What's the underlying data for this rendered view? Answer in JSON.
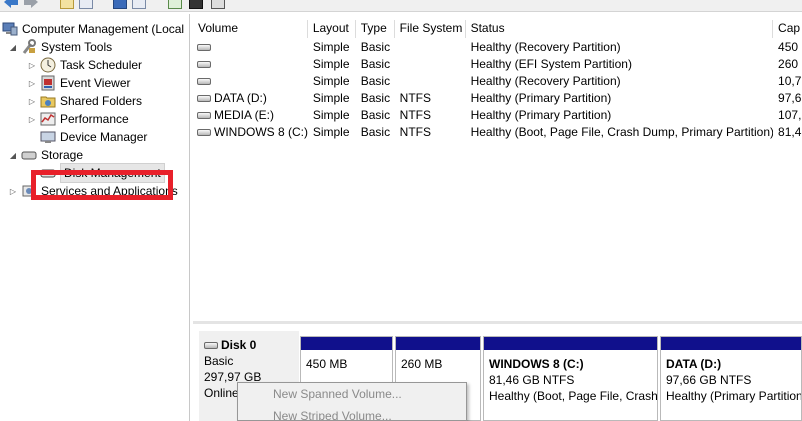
{
  "toolbar": {
    "buttons": [
      "back-arrow-icon",
      "forward-arrow-icon",
      "folder-up-icon",
      "show-hide-tree-icon",
      "help-icon",
      "show-hide-action-pane-icon",
      "export-icon",
      "properties-icon",
      "settings-icon"
    ]
  },
  "tree": {
    "root": "Computer Management (Local",
    "system_tools": "System Tools",
    "task_scheduler": "Task Scheduler",
    "event_viewer": "Event Viewer",
    "shared_folders": "Shared Folders",
    "performance": "Performance",
    "device_manager": "Device Manager",
    "storage": "Storage",
    "disk_management": "Disk Management",
    "services": "Services and Applications"
  },
  "list": {
    "columns": [
      "Volume",
      "Layout",
      "Type",
      "File System",
      "Status",
      "Cap"
    ],
    "rows": [
      {
        "volume": "",
        "layout": "Simple",
        "type": "Basic",
        "fs": "",
        "status": "Healthy (Recovery Partition)",
        "cap": "450"
      },
      {
        "volume": "",
        "layout": "Simple",
        "type": "Basic",
        "fs": "",
        "status": "Healthy (EFI System Partition)",
        "cap": "260"
      },
      {
        "volume": "",
        "layout": "Simple",
        "type": "Basic",
        "fs": "",
        "status": "Healthy (Recovery Partition)",
        "cap": "10,7"
      },
      {
        "volume": "DATA (D:)",
        "layout": "Simple",
        "type": "Basic",
        "fs": "NTFS",
        "status": "Healthy (Primary Partition)",
        "cap": "97,6"
      },
      {
        "volume": "MEDIA (E:)",
        "layout": "Simple",
        "type": "Basic",
        "fs": "NTFS",
        "status": "Healthy (Primary Partition)",
        "cap": "107,"
      },
      {
        "volume": "WINDOWS 8 (C:)",
        "layout": "Simple",
        "type": "Basic",
        "fs": "NTFS",
        "status": "Healthy (Boot, Page File, Crash Dump, Primary Partition)",
        "cap": "81,4"
      }
    ]
  },
  "disk": {
    "name": "Disk 0",
    "type": "Basic",
    "size": "297,97 GB",
    "status": "Online",
    "partitions": [
      {
        "title": "",
        "size": "450 MB",
        "status": ""
      },
      {
        "title": "",
        "size": "260 MB",
        "status": ""
      },
      {
        "title": "WINDOWS 8  (C:)",
        "size": "81,46 GB NTFS",
        "status": "Healthy (Boot, Page File, Crash"
      },
      {
        "title": "DATA  (D:)",
        "size": "97,66 GB NTFS",
        "status": "Healthy (Primary Partition"
      }
    ]
  },
  "context_menu": {
    "items": [
      "New Spanned Volume...",
      "New Striped Volume..."
    ]
  },
  "colors": {
    "partition_bar": "#10108c",
    "highlight": "#e8202a"
  }
}
